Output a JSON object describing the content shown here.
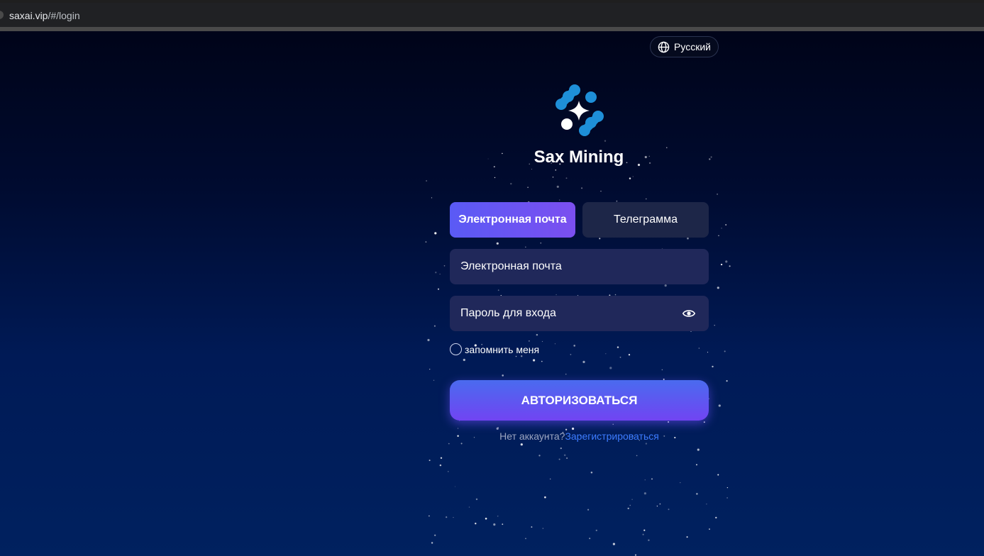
{
  "browser": {
    "url_host": "saxai.vip",
    "url_path": "/#/login"
  },
  "language": {
    "label": "Русский",
    "icon": "globe-icon"
  },
  "brand": {
    "name": "Sax Mining",
    "logo_icon": "sax-mining-logo",
    "logo_colors": [
      "#1e8fd8",
      "#ffffff"
    ]
  },
  "tabs": [
    {
      "label": "Электронная почта",
      "active": true
    },
    {
      "label": "Телеграмма",
      "active": false
    }
  ],
  "form": {
    "email_placeholder": "Электронная почта",
    "password_placeholder": "Пароль для входа",
    "password_toggle_icon": "eye-icon",
    "remember_label": "запомнить меня",
    "remember_checked": false,
    "submit_label": "АВТОРИЗОВАТЬСЯ"
  },
  "signup": {
    "prompt": "Нет аккаунта?",
    "link": "Зарегистрироваться"
  },
  "colors": {
    "accent_start": "#5a5af5",
    "accent_end": "#7b4ff0",
    "link": "#3d7bff",
    "field_bg": "#20285a"
  }
}
